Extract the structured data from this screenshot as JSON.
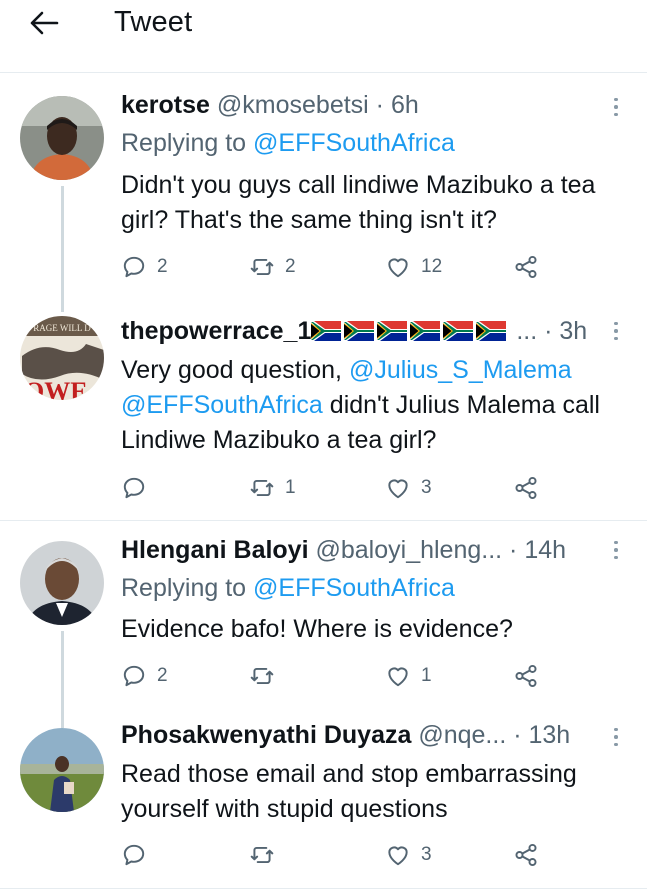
{
  "header": {
    "title": "Tweet"
  },
  "tweets": [
    {
      "name": "kerotse",
      "handle": "@kmosebetsi",
      "time": "6h",
      "replying_prefix": "Replying to",
      "replying_to": "@EFFSouthAfrica",
      "text": "Didn't you guys call lindiwe Mazibuko a tea girl? That's the same thing isn't it?",
      "replies": "2",
      "retweets": "2",
      "likes": "12"
    },
    {
      "name": "thepowerrace_1",
      "handle": "...",
      "time": "3h",
      "flag_count": 6,
      "text_mention": "@Julius_S_Malema",
      "text_before": "Very good question, ",
      "text_mention2": "@EFFSouthAfrica",
      "text_after": " didn't Julius Malema call Lindiwe Mazibuko a tea girl?",
      "replies": "",
      "retweets": "1",
      "likes": "3"
    },
    {
      "name": "Hlengani Baloyi",
      "handle": "@baloyi_hleng...",
      "time": "14h",
      "replying_prefix": "Replying to",
      "replying_to": "@EFFSouthAfrica",
      "text": "Evidence bafo! Where is evidence?",
      "replies": "2",
      "retweets": "",
      "likes": "1"
    },
    {
      "name": "Phosakwenyathi Duyaza",
      "handle": "@nqe...",
      "time": "13h",
      "text": "Read those email and stop embarrassing yourself with stupid questions",
      "replies": "",
      "retweets": "",
      "likes": "3"
    }
  ],
  "icons": {
    "back": "arrow-left-icon",
    "reply": "reply-icon",
    "retweet": "retweet-icon",
    "like": "heart-icon",
    "share": "share-icon",
    "more": "more-vertical-icon"
  },
  "colors": {
    "link": "#1d9bf0",
    "muted": "#536471",
    "divider": "#e6ecf0"
  }
}
